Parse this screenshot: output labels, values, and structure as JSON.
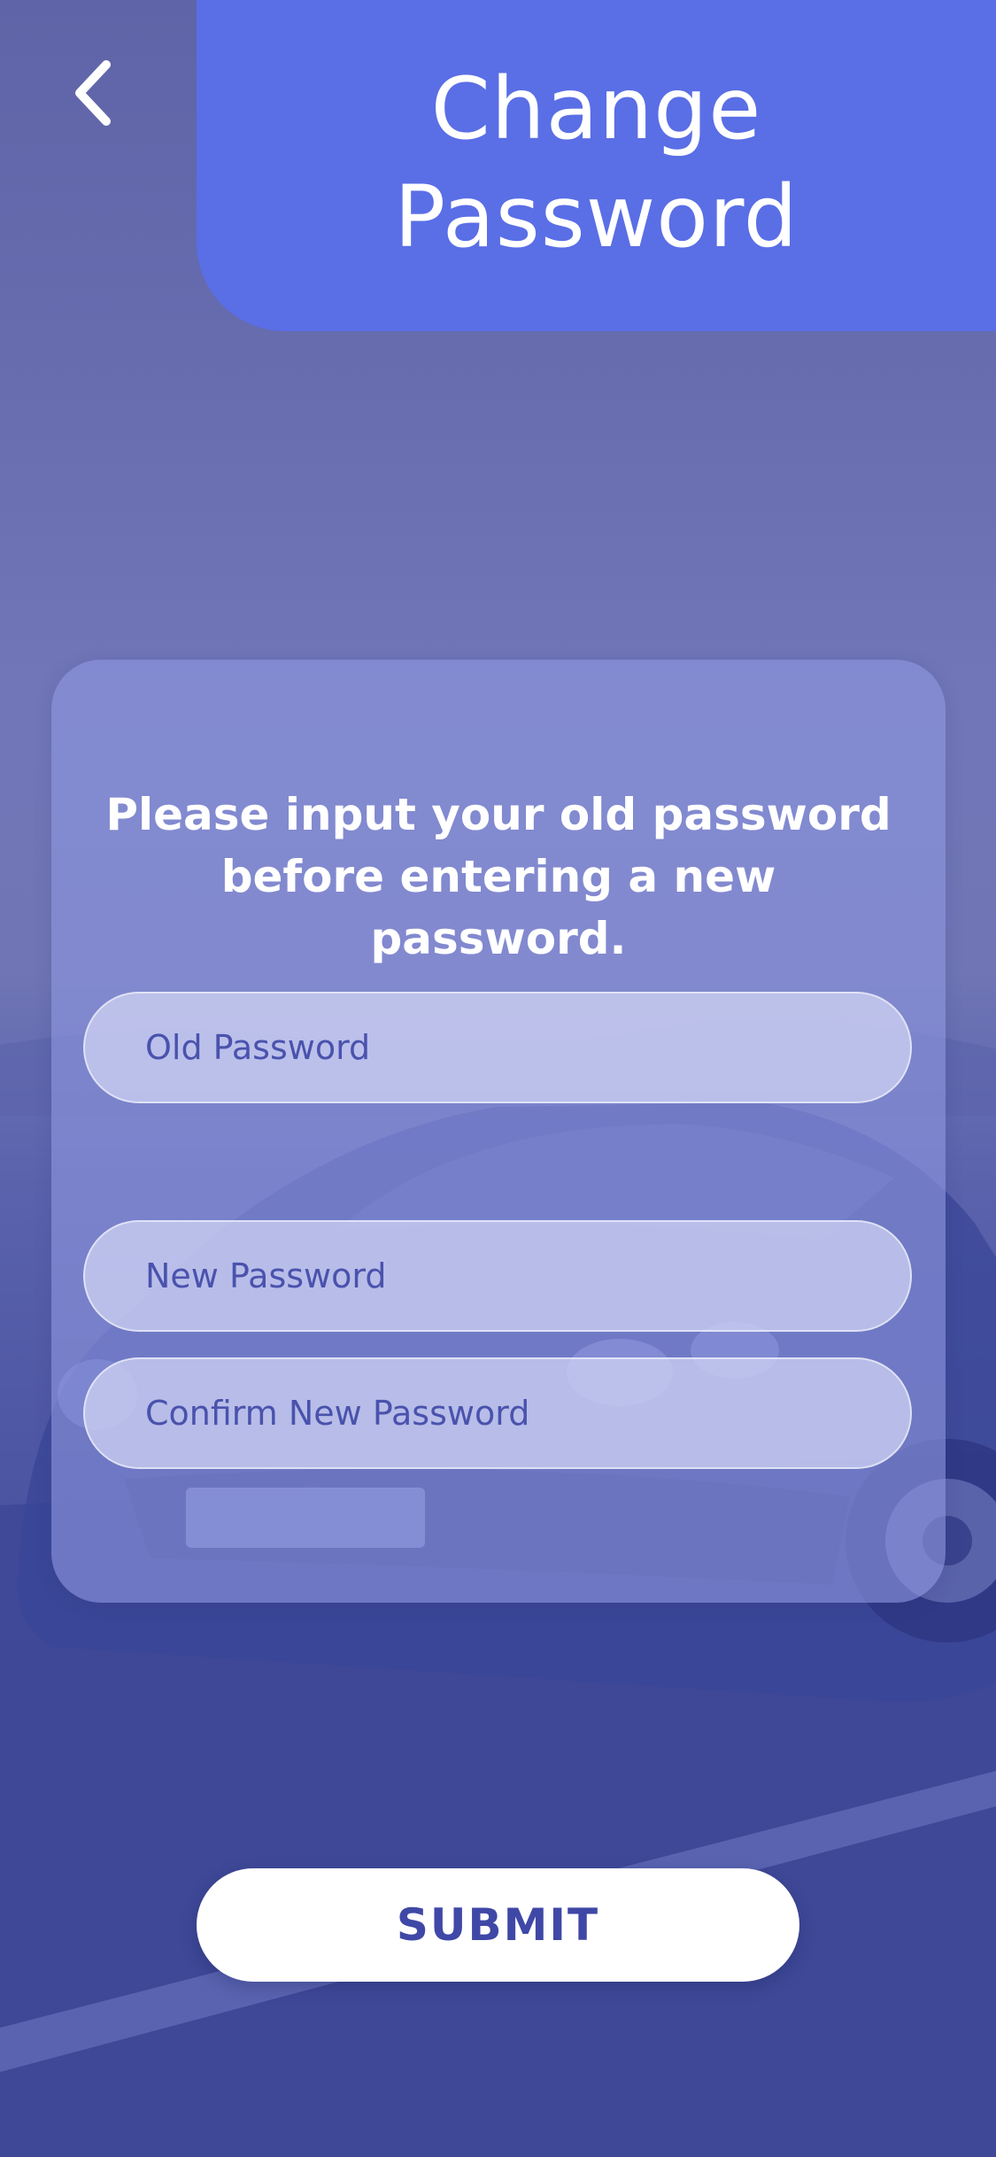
{
  "header": {
    "title": "Change\nPassword",
    "back_icon": "chevron-left-icon",
    "panel_color": "#5a6ee6"
  },
  "form": {
    "instruction": "Please input your old password\nbefore entering a new password.",
    "old_password": {
      "value": "",
      "placeholder": "Old Password"
    },
    "new_password": {
      "value": "",
      "placeholder": "New Password"
    },
    "confirm_password": {
      "value": "",
      "placeholder": "Confirm New Password"
    }
  },
  "submit": {
    "label": "SUBMIT"
  },
  "colors": {
    "accent": "#5a6ee6",
    "text_primary": "#ffffff",
    "button_text": "#3f48a6",
    "overlay": "#6a70b4"
  }
}
